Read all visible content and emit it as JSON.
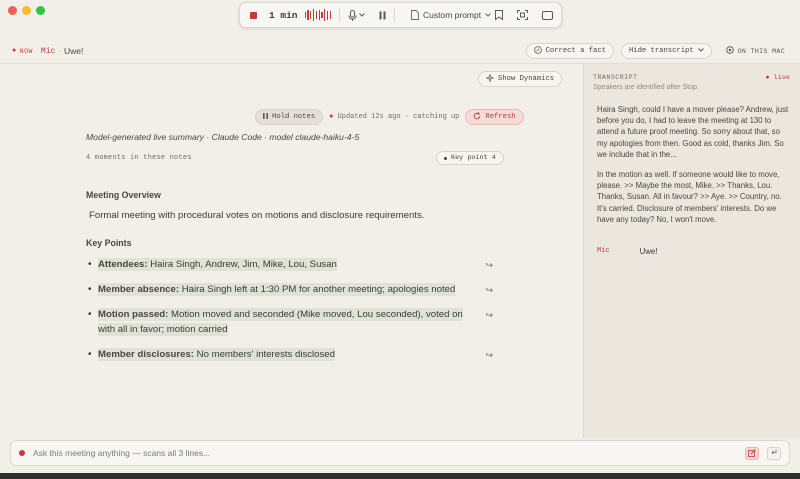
{
  "window": {
    "traffic_lights": [
      "close",
      "minimize",
      "maximize"
    ]
  },
  "recorder": {
    "timer": "1 min",
    "waveform_levels": [
      0.55,
      0.9,
      0.7,
      1.0,
      0.6,
      0.85,
      0.5,
      0.95,
      0.75,
      0.6
    ],
    "custom_prompt_label": "Custom prompt",
    "icons": [
      "stop-icon",
      "mic-icon",
      "chevron-down-icon",
      "pause-icon",
      "document-icon",
      "bookmark-icon",
      "screenshot-icon",
      "window-icon"
    ]
  },
  "status": {
    "now_label": "NOW",
    "mic_label": "Mic",
    "separator": "·",
    "speaker": "Uwe!",
    "correct_fact_label": "Correct a fact",
    "hide_transcript_label": "Hide transcript",
    "on_mac_label": "ON THIS MAC"
  },
  "summary": {
    "show_dynamics_label": "Show Dynamics",
    "hold_notes_label": "Hold notes",
    "updated_text": "Updated 12s ago",
    "catching_up_text": "· catching up",
    "refresh_label": "Refresh",
    "model_line": "Model-generated live summary · Claude Code · model claude-haiku-4-5",
    "moments_line": "4 moments in these notes",
    "key_point_pill": "Key point 4",
    "overview_heading": "Meeting Overview",
    "overview_text": "Formal meeting with procedural votes on motions and disclosure requirements.",
    "key_points_heading": "Key Points",
    "key_points": [
      {
        "label": "Attendees:",
        "text": "Haira Singh, Andrew, Jim, Mike, Lou, Susan"
      },
      {
        "label": "Member absence:",
        "text": "Haira Singh left at 1:30 PM for another meeting; apologies noted"
      },
      {
        "label": "Motion passed:",
        "text": "Motion moved and seconded (Mike moved, Lou seconded), voted on with all in favor; motion carried"
      },
      {
        "label": "Member disclosures:",
        "text": "No members' interests disclosed"
      }
    ],
    "bullet": "•",
    "jump_glyph": "↪"
  },
  "transcript": {
    "title": "TRANSCRIPT",
    "live_label": "live",
    "subtitle": "Speakers are identified after Stop.",
    "paragraphs": [
      "Haira Singh, could I have a mover please? Andrew, just before you do, I had to leave the meeting at 130 to attend a future proof meeting. So sorry about that, so my apologies from then. Good as cold, thanks Jim. So we include that in the...",
      "In the motion as well. If someone would like to move, please. >> Maybe the most, Mike. >> Thanks, Lou. Thanks, Susan. All in favour? >> Aye. >> Country, no. It's carried. Disclosure of members' interests. Do we have any today? No, I won't move."
    ],
    "last_speaker": "Mic",
    "last_text": "Uwe!"
  },
  "ask": {
    "placeholder": "Ask this meeting anything — scans all 3 lines..."
  },
  "colors": {
    "accent_red": "#c23b3b",
    "highlight": "#dfe3d6",
    "background": "#f2efe9",
    "sidebar": "#ebe7df"
  }
}
